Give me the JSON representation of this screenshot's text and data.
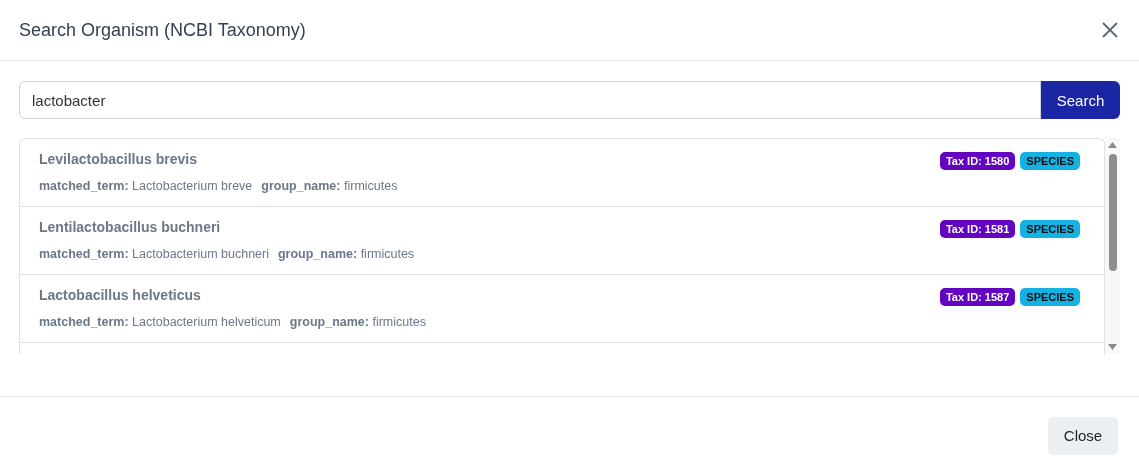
{
  "dialog": {
    "title": "Search Organism (NCBI Taxonomy)"
  },
  "search": {
    "value": "lactobacter",
    "button": "Search"
  },
  "results": [
    {
      "name": "Levilactobacillus brevis",
      "fields": [
        {
          "label": "matched_term:",
          "value": "Lactobacterium breve"
        },
        {
          "label": "group_name:",
          "value": "firmicutes"
        }
      ],
      "tax_id": "Tax ID: 1580",
      "rank": "SPECIES"
    },
    {
      "name": "Lentilactobacillus buchneri",
      "fields": [
        {
          "label": "matched_term:",
          "value": "Lactobacterium buchneri"
        },
        {
          "label": "group_name:",
          "value": "firmicutes"
        }
      ],
      "tax_id": "Tax ID: 1581",
      "rank": "SPECIES"
    },
    {
      "name": "Lactobacillus helveticus",
      "fields": [
        {
          "label": "matched_term:",
          "value": "Lactobacterium helveticum"
        },
        {
          "label": "group_name:",
          "value": "firmicutes"
        }
      ],
      "tax_id": "Tax ID: 1587",
      "rank": "SPECIES"
    }
  ],
  "footer": {
    "button": "Close"
  }
}
